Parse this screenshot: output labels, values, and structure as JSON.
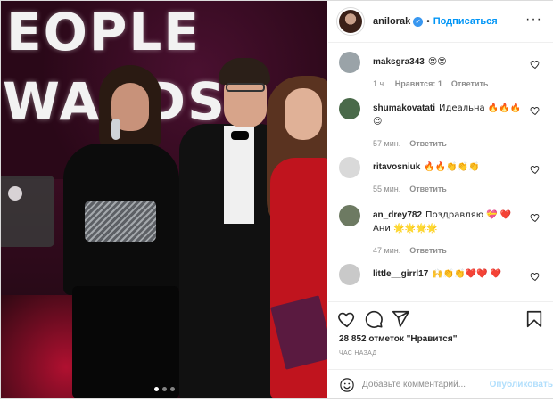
{
  "photo": {
    "banner_line1": "EOPLE",
    "banner_line2": "WARDS"
  },
  "header": {
    "username": "anilorak",
    "verified_mark": "✓",
    "separator": "•",
    "follow_label": "Подписаться",
    "more_label": "···"
  },
  "comments": [
    {
      "user": "maksgra343",
      "text": "😍😍",
      "time": "1 ч.",
      "likes": "Нравится: 1",
      "reply": "Ответить",
      "avatar_color": "#9aa3a8"
    },
    {
      "user": "shumakovatati",
      "text": "Идеальна 🔥🔥🔥 😍",
      "time": "57 мин.",
      "likes": "",
      "reply": "Ответить",
      "avatar_color": "#4a6a4a"
    },
    {
      "user": "ritavosniuk",
      "text": "🔥🔥👏👏👏",
      "time": "55 мин.",
      "likes": "",
      "reply": "Ответить",
      "avatar_color": "#d9d9d9"
    },
    {
      "user": "an_drey782",
      "text": "Поздравляю 💝 ❤️ Ани 🌟🌟🌟🌟",
      "time": "47 мин.",
      "likes": "",
      "reply": "Ответить",
      "avatar_color": "#6d7a62"
    },
    {
      "user": "little__girrl17",
      "text": "🙌👏👏❤️❤️ ❤️",
      "time": "",
      "likes": "",
      "reply": "",
      "avatar_color": "#c9c9c9"
    }
  ],
  "actions": {
    "likes_text": "28 852 отметок \"Нравится\"",
    "time_text": "ЧАС НАЗАД",
    "comment_placeholder": "Добавьте комментарий...",
    "post_label": "Опубликовать"
  },
  "icons": {
    "like": "heart-icon",
    "comment": "comment-icon",
    "share": "share-icon",
    "save": "bookmark-icon",
    "emoji": "smile-icon"
  },
  "colors": {
    "accent": "#0095f6",
    "post_disabled": "#b2dffc",
    "verified": "#3897f0",
    "meta": "#8e8e8e"
  }
}
